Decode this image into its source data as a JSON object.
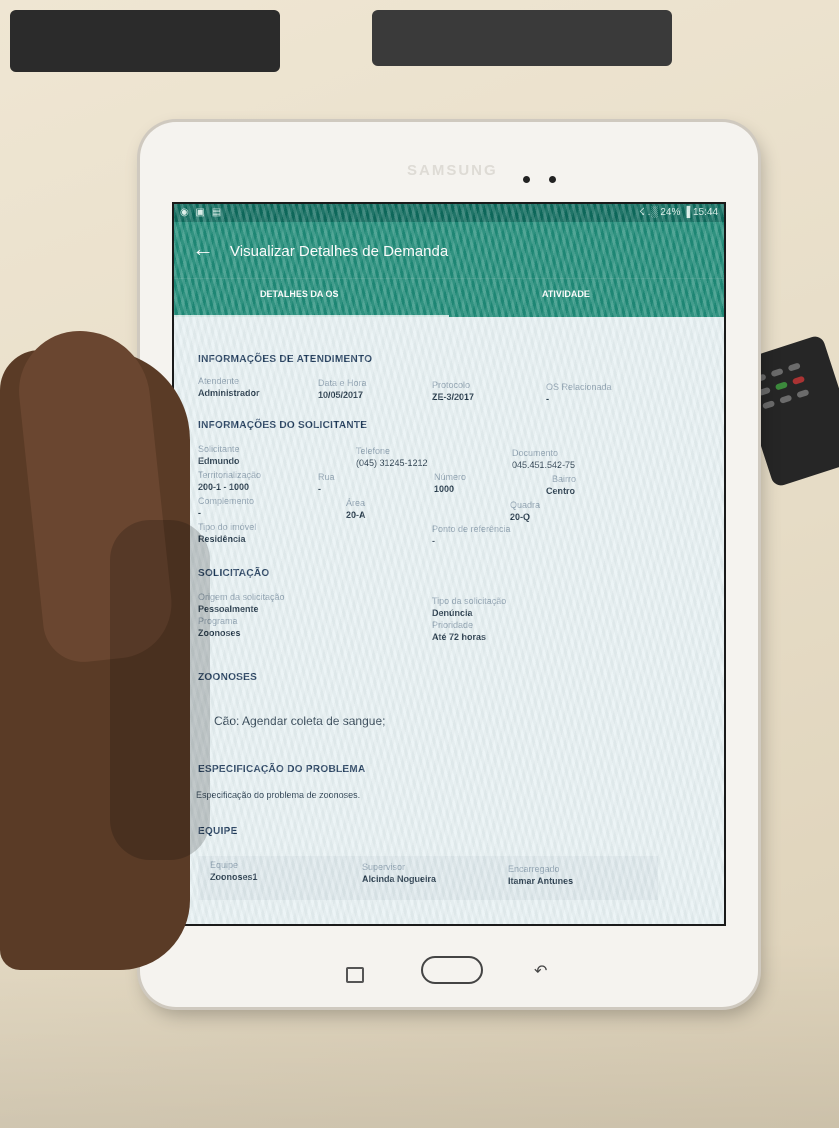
{
  "device": {
    "brand": "SAMSUNG"
  },
  "status_bar": {
    "left_icons": "◉ ▣ ▤",
    "right": "☇ .░ 24% ▐ 15:44"
  },
  "app_bar": {
    "back_icon": "←",
    "title": "Visualizar Detalhes de Demanda"
  },
  "tabs": [
    {
      "label": "DETALHES DA OS"
    },
    {
      "label": "ATIVIDADE"
    }
  ],
  "sections": {
    "atendimento": {
      "heading": "INFORMAÇÕES DE ATENDIMENTO",
      "fields": [
        {
          "label": "Atendente",
          "value": "Administrador"
        },
        {
          "label": "Data e Hora",
          "value": "10/05/2017"
        },
        {
          "label": "Protocolo",
          "value": "ZE-3/2017"
        },
        {
          "label": "OS Relacionada",
          "value": "-"
        }
      ]
    },
    "solicitante": {
      "heading": "INFORMAÇÕES DO SOLICITANTE",
      "fields": [
        {
          "label": "Solicitante",
          "value": "Edmundo"
        },
        {
          "label": "Telefone",
          "value": "(045) 31245-1212"
        },
        {
          "label": "Documento",
          "value": "045.451.542-75"
        },
        {
          "label": "Territorialização",
          "value": "200-1 - 1000"
        },
        {
          "label": "Rua",
          "value": "-"
        },
        {
          "label": "Número",
          "value": "1000"
        },
        {
          "label": "Bairro",
          "value": "Centro"
        },
        {
          "label": "Complemento",
          "value": "-"
        },
        {
          "label": "Área",
          "value": "20-A"
        },
        {
          "label": "Quadra",
          "value": "20-Q"
        },
        {
          "label": "Tipo do imóvel",
          "value": "Residência"
        },
        {
          "label": "Ponto de referência",
          "value": "-"
        }
      ]
    },
    "solicitacao": {
      "heading": "SOLICITAÇÃO",
      "fields": [
        {
          "label": "Origem da solicitação",
          "value": "Pessoalmente"
        },
        {
          "label": "Tipo da solicitação",
          "value": "Denúncia"
        },
        {
          "label": "Programa",
          "value": "Zoonoses"
        },
        {
          "label": "Prioridade",
          "value": "Até 72 horas"
        }
      ]
    },
    "zoonoses": {
      "heading": "ZOONOSES",
      "text": "Cão: Agendar coleta de sangue;"
    },
    "problema": {
      "heading": "ESPECIFICAÇÃO DO PROBLEMA",
      "text": "Especificação do problema de zoonoses."
    },
    "equipe": {
      "heading": "EQUIPE",
      "fields": [
        {
          "label": "Equipe",
          "value": "Zoonoses1"
        },
        {
          "label": "Supervisor",
          "value": "Alcinda Nogueira"
        },
        {
          "label": "Encarregado",
          "value": "Itamar Antunes"
        }
      ]
    }
  },
  "nav_buttons": {
    "recent_icon": "recent-apps-icon",
    "home_icon": "home-button",
    "back_icon": "↶"
  },
  "colors": {
    "app_bar": "#1f8c78",
    "status_bar": "#0d6b5d",
    "heading": "#1e3a5a"
  }
}
